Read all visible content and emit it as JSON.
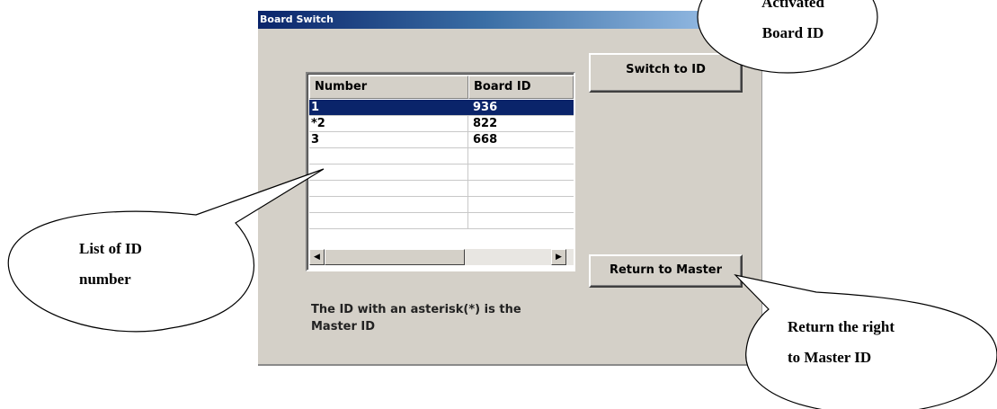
{
  "dialog": {
    "title": "Board Switch",
    "list": {
      "columns": [
        "Number",
        "Board ID"
      ],
      "rows": [
        {
          "number": "1",
          "board_id": "936",
          "selected": true
        },
        {
          "number": "*2",
          "board_id": "822",
          "selected": false
        },
        {
          "number": "3",
          "board_id": "668",
          "selected": false
        },
        {
          "number": "",
          "board_id": "",
          "selected": false
        },
        {
          "number": "",
          "board_id": "",
          "selected": false
        },
        {
          "number": "",
          "board_id": "",
          "selected": false
        },
        {
          "number": "",
          "board_id": "",
          "selected": false
        },
        {
          "number": "",
          "board_id": "",
          "selected": false
        }
      ],
      "scroll_left_icon": "arrow-left-icon",
      "scroll_right_icon": "arrow-right-icon"
    },
    "buttons": {
      "switch_label": "Switch to ID",
      "return_label": "Return to Master"
    },
    "note_line1": "The ID with an asterisk(*)  is the",
    "note_line2": "Master  ID"
  },
  "callouts": {
    "activated_line1": "Activated",
    "activated_line2": "Board ID",
    "list_line1": "List of ID",
    "list_line2": "number",
    "return_line1": "Return the right",
    "return_line2": "to Master ID"
  },
  "colors": {
    "dialog_face": "#d4d0c8",
    "title_gradient_start": "#0a246a",
    "title_gradient_end": "#a6caf0",
    "selection": "#0a246a"
  }
}
